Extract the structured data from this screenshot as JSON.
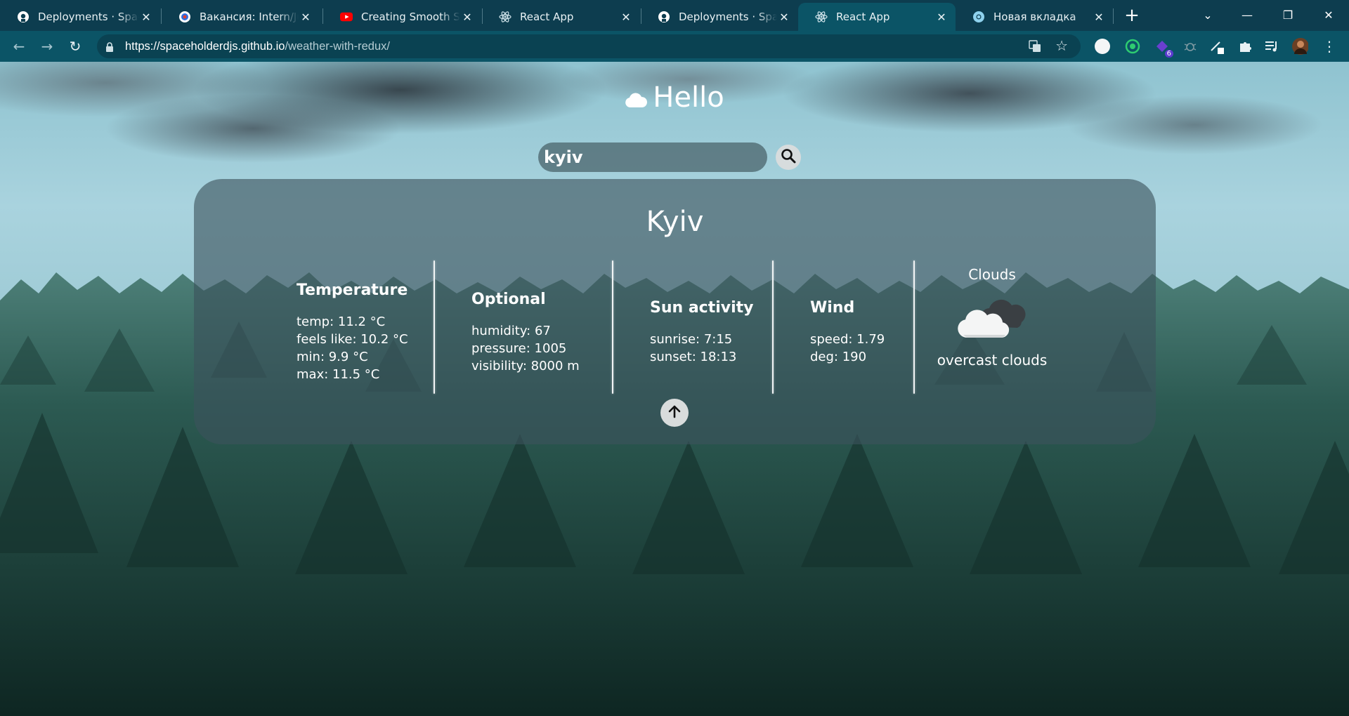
{
  "browser": {
    "tabs": [
      {
        "title": "Deployments · SpaceholderDJS",
        "favicon": "github-icon"
      },
      {
        "title": "Вакансия: Intern/Junior",
        "favicon": "hh-icon"
      },
      {
        "title": "Creating Smooth Scrolling",
        "favicon": "youtube-icon"
      },
      {
        "title": "React App",
        "favicon": "react-icon"
      },
      {
        "title": "Deployments · SpaceholderDJS",
        "favicon": "github-icon"
      },
      {
        "title": "React App",
        "favicon": "react-icon",
        "active": true
      },
      {
        "title": "Новая вкладка",
        "favicon": "chrome-icon"
      }
    ],
    "url_host": "https://spaceholderdjs.github.io",
    "url_path": "/weather-with-redux/",
    "extension_badge": "6",
    "colors": {
      "tabstrip": "#0d3d4f",
      "active_tab": "#0b5466",
      "omnibox": "#0a4252"
    }
  },
  "app": {
    "title": "Hello",
    "search": {
      "value": "kyiv"
    },
    "city": "Kyiv",
    "temperature": {
      "heading": "Temperature",
      "lines": [
        "temp: 11.2 °C",
        "feels like: 10.2 °C",
        "min: 9.9 °C",
        "max: 11.5 °C"
      ]
    },
    "optional": {
      "heading": "Optional",
      "lines": [
        "humidity: 67",
        "pressure: 1005",
        "visibility: 8000 m"
      ]
    },
    "sun": {
      "heading": "Sun activity",
      "lines": [
        "sunrise: 7:15",
        "sunset: 18:13"
      ]
    },
    "wind": {
      "heading": "Wind",
      "lines": [
        "speed: 1.79",
        "deg: 190"
      ]
    },
    "weather": {
      "main": "Clouds",
      "description": "overcast clouds",
      "icon": "overcast-clouds-icon"
    },
    "colors": {
      "card": "rgba(60,82,92,0.62)",
      "text": "#ffffff",
      "button": "#d9dcdc"
    }
  }
}
